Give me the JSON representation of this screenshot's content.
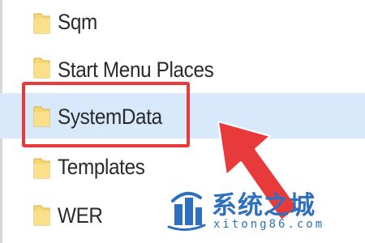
{
  "folders": [
    {
      "label": "Sqm",
      "icon": "folder-icon",
      "selected": false
    },
    {
      "label": "Start Menu Places",
      "icon": "folder-icon",
      "selected": false
    },
    {
      "label": "SystemData",
      "icon": "folder-icon",
      "selected": true
    },
    {
      "label": "Templates",
      "icon": "folder-icon",
      "selected": false
    },
    {
      "label": "WER",
      "icon": "folder-icon",
      "selected": false
    }
  ],
  "annotation": {
    "highlight_color": "#e83a3a",
    "arrow_color": "#e83a3a",
    "arrow_icon": "arrow-pointing-icon"
  },
  "watermark": {
    "title": "系统之城",
    "url": "xitong86.com",
    "color": "#2e6fbf",
    "logo_icon": "city-logo-icon"
  },
  "colors": {
    "selection_background": "#d7e9fb",
    "folder_yellow": "#f7d774"
  }
}
